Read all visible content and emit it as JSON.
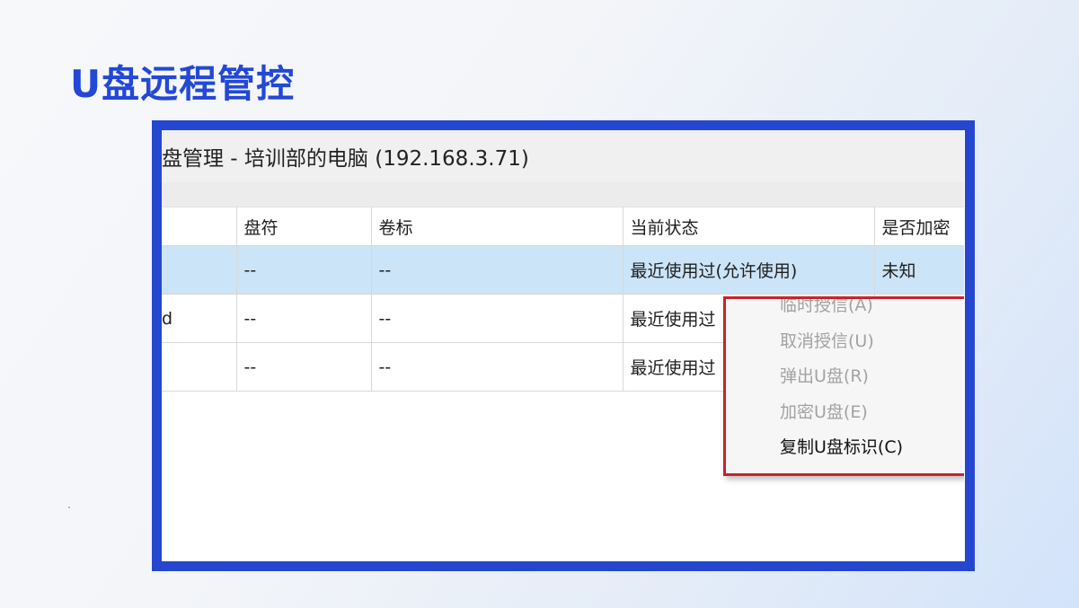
{
  "slide": {
    "title": "U盘远程管控"
  },
  "window": {
    "title": "盘管理 - 培训部的电脑 (192.168.3.71)"
  },
  "table": {
    "columns": [
      "",
      "盘符",
      "卷标",
      "当前状态",
      "是否加密"
    ],
    "rows": [
      {
        "name": "",
        "drive": "--",
        "label": "--",
        "status": "最近使用过(允许使用)",
        "encrypted": "未知",
        "selected": true
      },
      {
        "name": "d",
        "drive": "--",
        "label": "--",
        "status": "最近使用过",
        "encrypted": "",
        "selected": false
      },
      {
        "name": "",
        "drive": "--",
        "label": "--",
        "status": "最近使用过",
        "encrypted": "",
        "selected": false
      }
    ]
  },
  "context_menu": {
    "items": [
      {
        "label": "临时授信(A)",
        "enabled": false
      },
      {
        "label": "取消授信(U)",
        "enabled": false
      },
      {
        "label": "弹出U盘(R)",
        "enabled": false
      },
      {
        "label": "加密U盘(E)",
        "enabled": false
      },
      {
        "label": "复制U盘标识(C)",
        "enabled": true
      }
    ]
  },
  "colors": {
    "title_blue": "#2348d8",
    "frame_blue": "#2547cf",
    "selected_row": "#cce4f7",
    "menu_highlight_border": "#c9232b"
  }
}
